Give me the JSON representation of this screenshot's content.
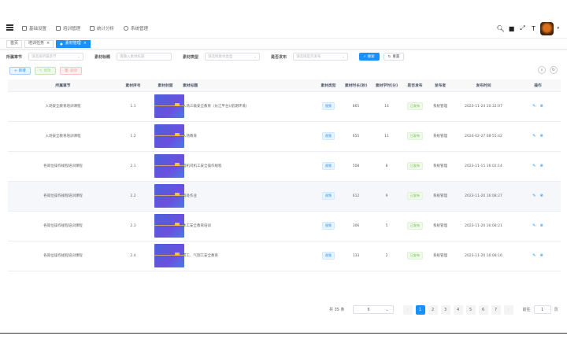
{
  "nav": {
    "menu": [
      {
        "label": "基础设置",
        "icon": "doc-icon"
      },
      {
        "label": "培训管理",
        "icon": "monitor-icon"
      },
      {
        "label": "统计分析",
        "icon": "chart-icon"
      },
      {
        "label": "系统管理",
        "icon": "gear-icon"
      }
    ],
    "right_icons": [
      "search-icon",
      "message-icon",
      "fullscreen-icon",
      "font-size-icon"
    ],
    "caret": "▾"
  },
  "tabs": [
    {
      "label": "首页",
      "active": false
    },
    {
      "label": "培训任务",
      "active": false,
      "closable": true
    },
    {
      "label": "素材管理",
      "active": true,
      "closable": true
    }
  ],
  "search": {
    "chapter_label": "所属章节",
    "chapter_placeholder": "请选择所属章节",
    "title_label": "素材标题",
    "title_placeholder": "请输入素材标题",
    "type_label": "素材类型",
    "type_placeholder": "请选择素材类型",
    "publish_label": "是否发布",
    "publish_placeholder": "请选择是否发布",
    "search_btn": "搜索",
    "reset_btn": "重置"
  },
  "toolbar": {
    "add": "新增",
    "edit": "修改",
    "delete": "删除"
  },
  "table": {
    "headers": [
      "所属章节",
      "素材序号",
      "素材封面",
      "素材标题",
      "素材类型",
      "素材时长(秒)",
      "素材学时(分)",
      "是否发布",
      "发布者",
      "发布时间",
      "操作"
    ],
    "rows": [
      {
        "chapter": "入场安全教育培训课程",
        "seq": "1.1",
        "title": "入场三级安全教育（长江平台)/前期环境)",
        "type": "视频",
        "duration": "865",
        "hours": "14",
        "status": "已发布",
        "publisher": "系统管理",
        "time": "2023-11-24 10:32:07"
      },
      {
        "chapter": "入场安全教育培训课程",
        "seq": "1.2",
        "title": "入场教育",
        "type": "视频",
        "duration": "655",
        "hours": "11",
        "status": "已发布",
        "publisher": "系统管理",
        "time": "2024-02-27 08:55:42"
      },
      {
        "chapter": "各岗位操作规程培训课程",
        "seq": "2.1",
        "title": "塔机司机工安全操作规程",
        "type": "视频",
        "duration": "508",
        "hours": "8",
        "status": "已发布",
        "publisher": "系统管理",
        "time": "2023-11-15 16:02:14"
      },
      {
        "chapter": "各岗位操作规程培训课程",
        "seq": "2.2",
        "title": "高处作业",
        "type": "视频",
        "duration": "612",
        "hours": "9",
        "status": "已发布",
        "publisher": "系统管理",
        "time": "2023-11-20 16:08:27"
      },
      {
        "chapter": "各岗位操作规程培训课程",
        "seq": "2.3",
        "title": "木工安全教育培训",
        "type": "视频",
        "duration": "306",
        "hours": "5",
        "status": "已发布",
        "publisher": "系统管理",
        "time": "2023-11-20 16:08:21"
      },
      {
        "chapter": "各岗位操作规程培训课程",
        "seq": "2.4",
        "title": "焊工、气割工安全教育",
        "type": "视频",
        "duration": "133",
        "hours": "2",
        "status": "已发布",
        "publisher": "系统管理",
        "time": "2023-11-20 16:08:16"
      }
    ]
  },
  "pagination": {
    "total": "共 35 条",
    "page_size": "6",
    "pages": [
      "1",
      "2",
      "3",
      "4",
      "5",
      "6",
      "7"
    ],
    "current": "1",
    "prev": "‹",
    "next": "›",
    "jump_prefix": "前往",
    "jump_value": "1",
    "jump_suffix": "页"
  }
}
